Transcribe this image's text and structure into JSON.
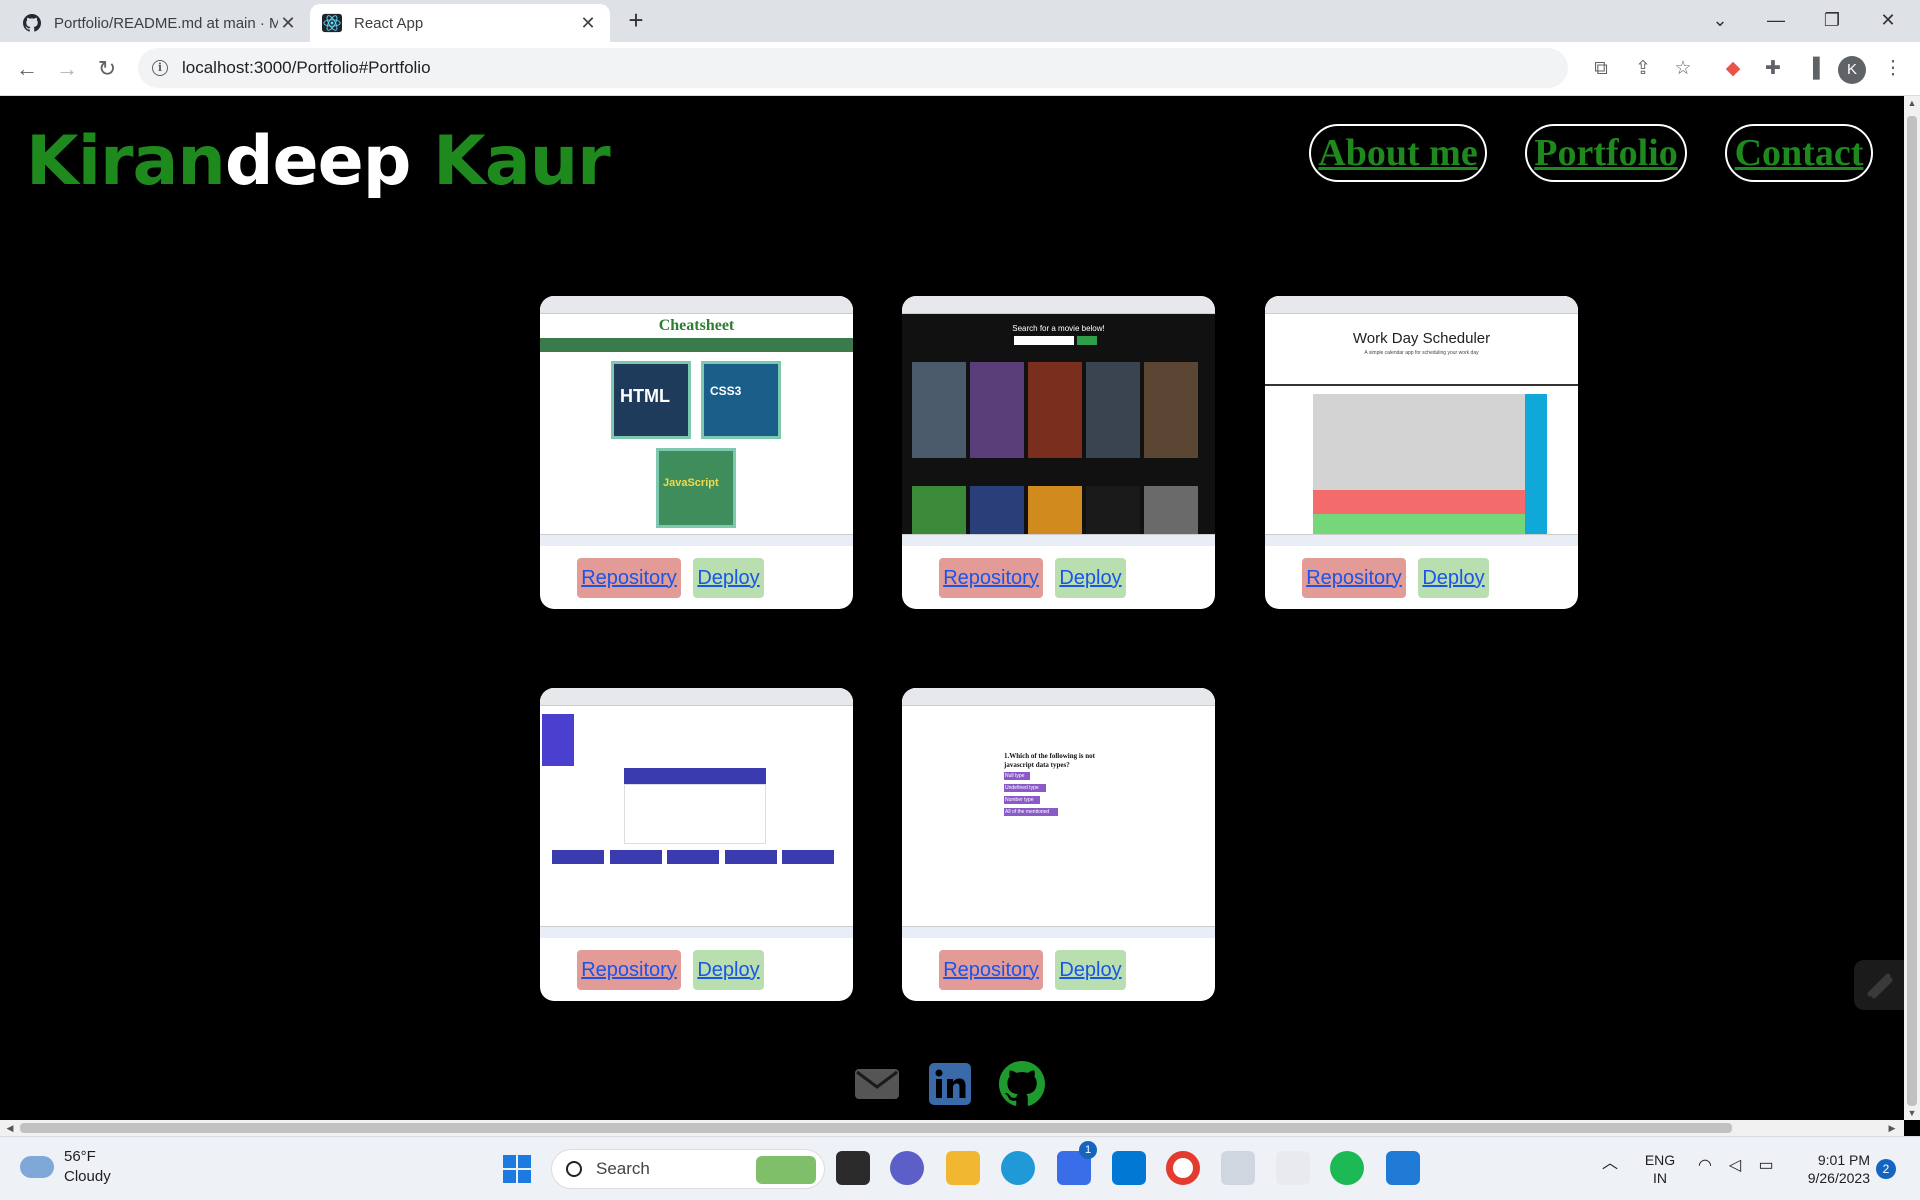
{
  "browser": {
    "tabs": [
      {
        "title": "Portfolio/README.md at main · M",
        "icon": "github-icon"
      },
      {
        "title": "React App",
        "icon": "react-icon"
      }
    ],
    "url": "localhost:3000/Portfolio#Portfolio",
    "profile_initial": "K"
  },
  "page": {
    "brand": {
      "part1": "Kiran",
      "part2": "deep",
      "part3": "Kaur"
    },
    "nav": {
      "about": "About me",
      "portfolio": "Portfolio",
      "contact": "Contact"
    },
    "projects": [
      {
        "preview": "cheatsheet",
        "preview_title": "Cheatsheet",
        "repo_label": "Repository",
        "deploy_label": "Deploy"
      },
      {
        "preview": "movie-search",
        "preview_title": "Search for a movie below!",
        "repo_label": "Repository",
        "deploy_label": "Deploy"
      },
      {
        "preview": "work-day-scheduler",
        "preview_title": "Work Day Scheduler",
        "preview_subtitle": "A simple calendar app for scheduling your work day",
        "repo_label": "Repository",
        "deploy_label": "Deploy"
      },
      {
        "preview": "weather-dashboard",
        "repo_label": "Repository",
        "deploy_label": "Deploy"
      },
      {
        "preview": "javascript-quiz",
        "preview_question": "1.Which of the following is not javascript data types?",
        "preview_options": [
          "Null type",
          "Undefined type",
          "Number type",
          "All of the mentioned"
        ],
        "repo_label": "Repository",
        "deploy_label": "Deploy"
      }
    ],
    "social": [
      "email-icon",
      "linkedin-icon",
      "github-icon"
    ]
  },
  "taskbar": {
    "weather_temp": "56°F",
    "weather_desc": "Cloudy",
    "search_placeholder": "Search",
    "store_badge": "1",
    "lang_line1": "ENG",
    "lang_line2": "IN",
    "time": "9:01 PM",
    "date": "9/26/2023",
    "notification_count": "2"
  },
  "colors": {
    "brand_green": "#1e8a1e",
    "repo_bg": "#e39b98",
    "deploy_bg": "#b9dfb0",
    "link_blue": "#1a55e8"
  }
}
